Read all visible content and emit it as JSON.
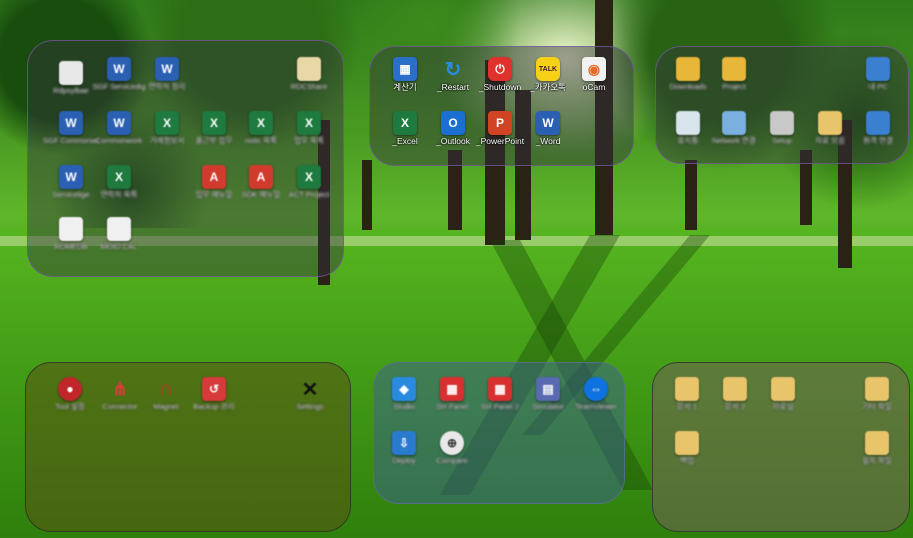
{
  "desktop": {
    "groups": [
      {
        "id": "top-left",
        "icons": [
          {
            "label": "Rdpsylbae",
            "icon": "file-icon",
            "color": "#e8e8e8",
            "glyph": ""
          },
          {
            "label": "SGF Servicedig",
            "icon": "word-doc-icon",
            "color": "#2b5fb4",
            "glyph": "W"
          },
          {
            "label": "연락처 정리",
            "icon": "word-doc-icon",
            "color": "#2b5fb4",
            "glyph": "W"
          },
          {
            "label": "RDCShare",
            "icon": "file-icon",
            "color": "#e8d8a8",
            "glyph": ""
          },
          {
            "label": "SGF Commonwo",
            "icon": "word-doc-icon",
            "color": "#2b5fb4",
            "glyph": "W"
          },
          {
            "label": "Commonwork",
            "icon": "word-doc-icon",
            "color": "#2b5fb4",
            "glyph": "W"
          },
          {
            "label": "거래정보서",
            "icon": "excel-doc-icon",
            "color": "#1e7a3e",
            "glyph": "X"
          },
          {
            "label": "출근부 업무",
            "icon": "excel-doc-icon",
            "color": "#1e7a3e",
            "glyph": "X"
          },
          {
            "label": "notic 목록",
            "icon": "excel-doc-icon",
            "color": "#1e7a3e",
            "glyph": "X"
          },
          {
            "label": "업무 목록",
            "icon": "excel-doc-icon",
            "color": "#1e7a3e",
            "glyph": "X"
          },
          {
            "label": "Servicelige",
            "icon": "word-doc-icon",
            "color": "#2b5fb4",
            "glyph": "W"
          },
          {
            "label": "연락처 목록",
            "icon": "excel-doc-icon",
            "color": "#1e7a3e",
            "glyph": "X"
          },
          {
            "label": "업무 매뉴얼",
            "icon": "pdf-icon",
            "color": "#d13b2e",
            "glyph": "A"
          },
          {
            "label": "SDK 매뉴얼",
            "icon": "pdf-icon",
            "color": "#d13b2e",
            "glyph": "A"
          },
          {
            "label": "ACT Project",
            "icon": "excel-doc-icon",
            "color": "#1e7a3e",
            "glyph": "X"
          },
          {
            "label": "RDMEDB",
            "icon": "file-icon",
            "color": "#f0f0f0",
            "glyph": ""
          },
          {
            "label": "MOID CAL",
            "icon": "file-icon",
            "color": "#f0f0f0",
            "glyph": ""
          }
        ]
      },
      {
        "id": "top-center",
        "icons": [
          {
            "label": "계산기",
            "icon": "calculator-icon",
            "color": "#2a6fc9",
            "glyph": "▦"
          },
          {
            "label": "_Restart",
            "icon": "restart-icon",
            "color": "#2a6fc9",
            "glyph": "↻"
          },
          {
            "label": "_Shutdown",
            "icon": "shutdown-icon",
            "color": "#e0322d",
            "glyph": "⏻"
          },
          {
            "label": "_카카오톡",
            "icon": "kakaotalk-icon",
            "color": "#f7d117",
            "glyph": "TALK"
          },
          {
            "label": "oCam",
            "icon": "ocam-icon",
            "color": "#e86a2a",
            "glyph": "◉"
          },
          {
            "label": "_Excel",
            "icon": "excel-icon",
            "color": "#1e7a3e",
            "glyph": "X"
          },
          {
            "label": "_Outlook",
            "icon": "outlook-icon",
            "color": "#1a6fd0",
            "glyph": "O"
          },
          {
            "label": "_PowerPoint",
            "icon": "powerpoint-icon",
            "color": "#d04423",
            "glyph": "P"
          },
          {
            "label": "_Word",
            "icon": "word-icon",
            "color": "#2b5fb4",
            "glyph": "W"
          }
        ]
      },
      {
        "id": "top-right",
        "icons": [
          {
            "label": "Downloads",
            "icon": "folder-icon",
            "color": "#e8b73a",
            "glyph": ""
          },
          {
            "label": "Project",
            "icon": "folder-icon",
            "color": "#e8b73a",
            "glyph": ""
          },
          {
            "label": "내 PC",
            "icon": "computer-icon",
            "color": "#3b7fd0",
            "glyph": ""
          },
          {
            "label": "휴지통",
            "icon": "recycle-bin-icon",
            "color": "#d8e4ec",
            "glyph": ""
          },
          {
            "label": "Network 연결",
            "icon": "network-icon",
            "color": "#7ab0e0",
            "glyph": ""
          },
          {
            "label": "Setup",
            "icon": "drive-icon",
            "color": "#c8c8c8",
            "glyph": ""
          },
          {
            "label": "자료 모음",
            "icon": "folder-doc-icon",
            "color": "#e8c46a",
            "glyph": ""
          },
          {
            "label": "원격 연결",
            "icon": "remote-icon",
            "color": "#3b7fd0",
            "glyph": ""
          }
        ]
      },
      {
        "id": "bottom-left",
        "icons": [
          {
            "label": "Tool 설정",
            "icon": "app-red-icon",
            "color": "#c0262a",
            "glyph": "●"
          },
          {
            "label": "Connector",
            "icon": "share-icon",
            "color": "#d83a3a",
            "glyph": "⋔"
          },
          {
            "label": "Magnet",
            "icon": "magnet-icon",
            "color": "#cc2a2a",
            "glyph": "∩"
          },
          {
            "label": "Backup 관리",
            "icon": "backup-icon",
            "color": "#d63a3a",
            "glyph": "↺"
          },
          {
            "label": "Settings",
            "icon": "tools-icon",
            "color": "#202020",
            "glyph": "✕"
          }
        ]
      },
      {
        "id": "bottom-center",
        "icons": [
          {
            "label": "Studio",
            "icon": "studio-icon",
            "color": "#2a8ae0",
            "glyph": "◆"
          },
          {
            "label": "SH Panel",
            "icon": "panel-red-icon",
            "color": "#d83030",
            "glyph": "▦"
          },
          {
            "label": "SH Panel 2",
            "icon": "panel-red-icon",
            "color": "#d83030",
            "glyph": "▦"
          },
          {
            "label": "Simulator",
            "icon": "simulator-icon",
            "color": "#5a6ab0",
            "glyph": "▤"
          },
          {
            "label": "TeamViewer",
            "icon": "teamviewer-icon",
            "color": "#0e73e0",
            "glyph": "⇔"
          },
          {
            "label": "Deploy",
            "icon": "deploy-icon",
            "color": "#2a7ad0",
            "glyph": "⇩"
          },
          {
            "label": "Compare",
            "icon": "compare-icon",
            "color": "#e8e8e8",
            "glyph": "⊕"
          }
        ]
      },
      {
        "id": "bottom-right",
        "icons": [
          {
            "label": "문서 1",
            "icon": "folder-doc-icon",
            "color": "#e8c46a",
            "glyph": ""
          },
          {
            "label": "문서 2",
            "icon": "folder-doc-icon",
            "color": "#e8c46a",
            "glyph": ""
          },
          {
            "label": "자료실",
            "icon": "folder-doc-icon",
            "color": "#e8c46a",
            "glyph": ""
          },
          {
            "label": "기타 파일",
            "icon": "folder-doc-icon",
            "color": "#e8c46a",
            "glyph": ""
          },
          {
            "label": "백업",
            "icon": "folder-doc-icon",
            "color": "#e8c46a",
            "glyph": ""
          },
          {
            "label": "설치 파일",
            "icon": "folder-doc-icon",
            "color": "#e8c46a",
            "glyph": ""
          }
        ]
      }
    ]
  }
}
